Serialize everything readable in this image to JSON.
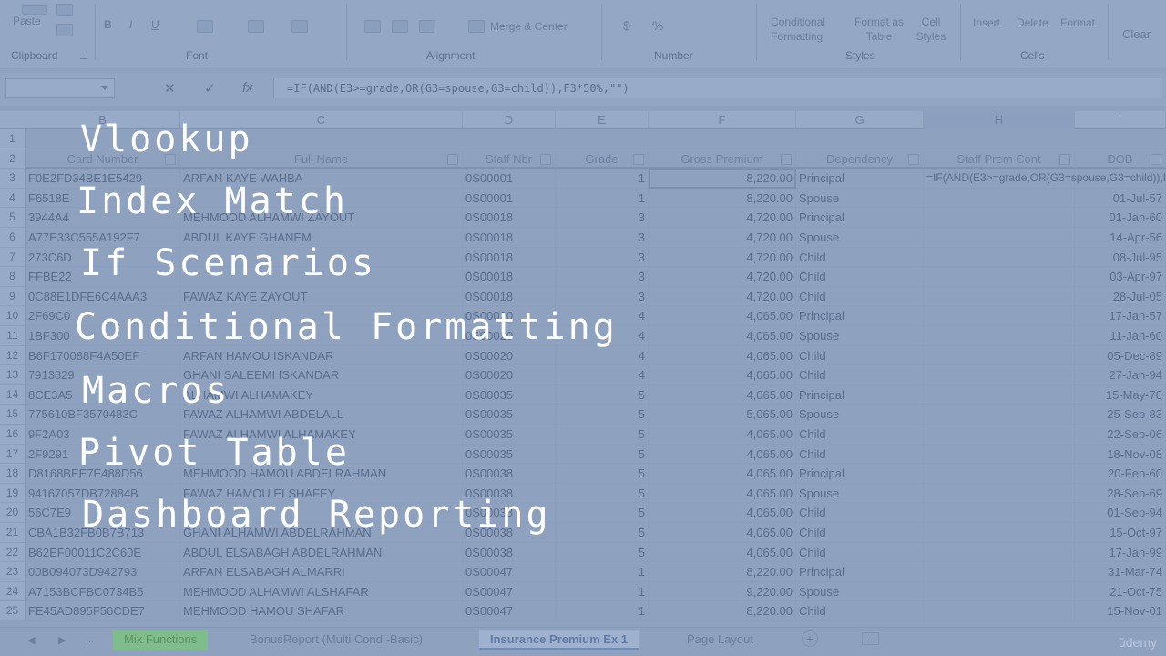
{
  "ribbon": {
    "paste": "Paste",
    "merge_center": "Merge & Center",
    "conditional_formatting": "Conditional Formatting",
    "format_as_table": "Format as Table",
    "cell_styles": "Cell Styles",
    "insert": "Insert",
    "delete": "Delete",
    "format": "Format",
    "clear": "Clear",
    "currency": "$",
    "percent": "%",
    "groups": {
      "clipboard": "Clipboard",
      "font": "Font",
      "alignment": "Alignment",
      "number": "Number",
      "styles": "Styles",
      "cells": "Cells"
    }
  },
  "formula_bar": {
    "cancel": "✕",
    "enter": "✓",
    "fx": "fx",
    "formula": "=IF(AND(E3>=grade,OR(G3=spouse,G3=child)),F3*50%,\"\")"
  },
  "columns": [
    "B",
    "C",
    "D",
    "E",
    "F",
    "G",
    "H",
    "I"
  ],
  "row_numbers": [
    "1",
    "2",
    "3",
    "4",
    "5",
    "6",
    "7",
    "8",
    "9",
    "10",
    "11",
    "12",
    "13",
    "14",
    "15",
    "16",
    "17",
    "18",
    "19",
    "20",
    "21",
    "22",
    "23",
    "24",
    "25"
  ],
  "table": {
    "headers": [
      "Card Number",
      "Full Name",
      "Staff Nbr",
      "Grade",
      "Gross Premium",
      "Dependency",
      "Staff Prem Cont",
      "DOB"
    ],
    "rows": [
      [
        "F0E2FD34BE1E5429",
        "ARFAN KAYE WAHBA",
        "0S00001",
        "1",
        "8,220.00",
        "Principal",
        "=IF(AND(E3>=grade,OR(G3=spouse,G3=child)),F3*50%,\"\")",
        ""
      ],
      [
        "F6518E",
        "",
        "0S00001",
        "1",
        "8,220.00",
        "Spouse",
        "",
        "01-Jul-57"
      ],
      [
        "3944A4",
        "MEHMOOD ALHAMWI ZAYOUT",
        "0S00018",
        "3",
        "4,720.00",
        "Principal",
        "",
        "01-Jan-60"
      ],
      [
        "A77E33C555A192F7",
        "ABDUL KAYE GHANEM",
        "0S00018",
        "3",
        "4,720.00",
        "Spouse",
        "",
        "14-Apr-56"
      ],
      [
        "273C6D",
        "",
        "0S00018",
        "3",
        "4,720.00",
        "Child",
        "",
        "08-Jul-95"
      ],
      [
        "FFBE22",
        "",
        "0S00018",
        "3",
        "4,720.00",
        "Child",
        "",
        "03-Apr-97"
      ],
      [
        "0C88E1DFE6C4AAA3",
        "FAWAZ KAYE ZAYOUT",
        "0S00018",
        "3",
        "4,720.00",
        "Child",
        "",
        "28-Jul-05"
      ],
      [
        "2F69C0",
        "",
        "0S00020",
        "4",
        "4,065.00",
        "Principal",
        "",
        "17-Jan-57"
      ],
      [
        "1BF300",
        "",
        "0S00020",
        "4",
        "4,065.00",
        "Spouse",
        "",
        "11-Jan-60"
      ],
      [
        "B6F170088F4A50EF",
        "ARFAN HAMOU ISKANDAR",
        "0S00020",
        "4",
        "4,065.00",
        "Child",
        "",
        "05-Dec-89"
      ],
      [
        "7913829",
        "GHANI SALEEMI ISKANDAR",
        "0S00020",
        "4",
        "4,065.00",
        "Child",
        "",
        "27-Jan-94"
      ],
      [
        "8CE3A5",
        "ALHAMWI ALHAMAKEY",
        "0S00035",
        "5",
        "4,065.00",
        "Principal",
        "",
        "15-May-70"
      ],
      [
        "775610BF3570483C",
        "FAWAZ ALHAMWI ABDELALL",
        "0S00035",
        "5",
        "5,065.00",
        "Spouse",
        "",
        "25-Sep-83"
      ],
      [
        "9F2A03",
        "FAWAZ ALHAMWI ALHAMAKEY",
        "0S00035",
        "5",
        "4,065.00",
        "Child",
        "",
        "22-Sep-06"
      ],
      [
        "2F9291",
        "",
        "0S00035",
        "5",
        "4,065.00",
        "Child",
        "",
        "18-Nov-08"
      ],
      [
        "D8168BEE7E488D56",
        "MEHMOOD HAMOU ABDELRAHMAN",
        "0S00038",
        "5",
        "4,065.00",
        "Principal",
        "",
        "20-Feb-60"
      ],
      [
        "94167057DB72884B",
        "FAWAZ HAMOU ELSHAFEY",
        "0S00038",
        "5",
        "4,065.00",
        "Spouse",
        "",
        "28-Sep-69"
      ],
      [
        "56C7E9",
        "",
        "0S00038",
        "5",
        "4,065.00",
        "Child",
        "",
        "01-Sep-94"
      ],
      [
        "CBA1B32FB0B7B713",
        "GHANI ALHAMWI ABDELRAHMAN",
        "0S00038",
        "5",
        "4,065.00",
        "Child",
        "",
        "15-Oct-97"
      ],
      [
        "B62EF00011C2C60E",
        "ABDUL ELSABAGH ABDELRAHMAN",
        "0S00038",
        "5",
        "4,065.00",
        "Child",
        "",
        "17-Jan-99"
      ],
      [
        "00B094073D942793",
        "ARFAN ELSABAGH ALMARRI",
        "0S00047",
        "1",
        "8,220.00",
        "Principal",
        "",
        "31-Mar-74"
      ],
      [
        "A7153BCFBC0734B5",
        "MEHMOOD ALHAMWI ALSHAFAR",
        "0S00047",
        "1",
        "9,220.00",
        "Spouse",
        "",
        "21-Oct-75"
      ],
      [
        "FE45AD895F56CDE7",
        "MEHMOOD HAMOU SHAFAR",
        "0S00047",
        "1",
        "8,220.00",
        "Child",
        "",
        "15-Nov-01"
      ]
    ]
  },
  "sheet_tabs": {
    "prev": "◀",
    "next": "▶",
    "more": "...",
    "tabs": [
      "Mix Functions",
      "BonusReport (Multi Cond -Basic)",
      "Insurance Premium Ex 1",
      "Page Layout"
    ],
    "add": "+",
    "more_right": "...",
    "watermark": "ūdemy"
  },
  "overlay": {
    "items": [
      "Vlookup",
      "Index Match",
      "If Scenarios",
      "Conditional Formatting",
      "Macros",
      "Pivot Table",
      "Dashboard Reporting"
    ]
  },
  "colors": {
    "overlay_text": "#ffffff",
    "wash": "#8ea2c0",
    "active_tab": "#6d8cc0",
    "green_tab": "#7fbd8c"
  }
}
